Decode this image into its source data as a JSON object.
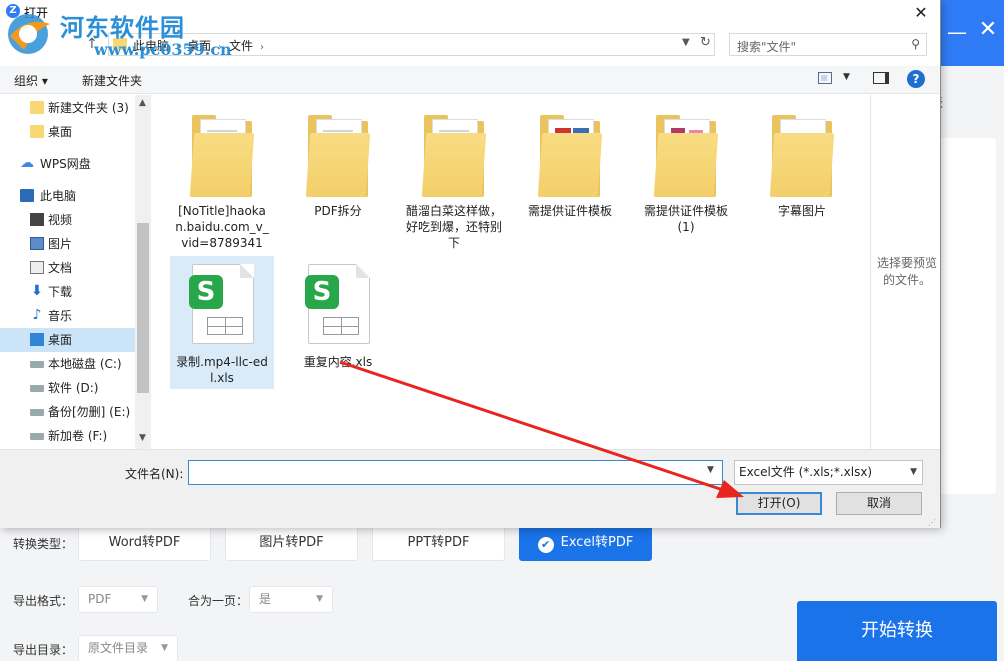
{
  "app": {
    "list_label": "表",
    "convert_type_label": "转换类型：",
    "type_buttons": [
      "Word转PDF",
      "图片转PDF",
      "PPT转PDF",
      "Excel转PDF"
    ],
    "export_format_label": "导出格式：",
    "export_format_value": "PDF",
    "merge_label": "合为一页：",
    "merge_value": "是",
    "export_dir_label": "导出目录：",
    "export_dir_value": "原文件目录",
    "start_button": "开始转换"
  },
  "watermark": {
    "name": "河东软件园",
    "url": "www.pc0359.cn"
  },
  "dialog": {
    "title": "打开",
    "breadcrumbs": [
      "此电脑",
      "桌面",
      "文件"
    ],
    "search_placeholder": "搜索\"文件\"",
    "toolbar": {
      "organize": "组织 ▾",
      "new_folder": "新建文件夹"
    },
    "nav_items": [
      {
        "label": "新建文件夹 (3)",
        "icon": "folder-icon"
      },
      {
        "label": "桌面",
        "icon": "folder-icon"
      },
      {
        "label": "WPS网盘",
        "icon": "cloud-icon"
      },
      {
        "label": "此电脑",
        "icon": "computer-icon"
      },
      {
        "label": "视频",
        "icon": "video-icon"
      },
      {
        "label": "图片",
        "icon": "picture-icon"
      },
      {
        "label": "文档",
        "icon": "document-icon"
      },
      {
        "label": "下载",
        "icon": "download-icon"
      },
      {
        "label": "音乐",
        "icon": "music-icon"
      },
      {
        "label": "桌面",
        "icon": "desktop-icon"
      },
      {
        "label": "本地磁盘 (C:)",
        "icon": "drive-icon"
      },
      {
        "label": "软件 (D:)",
        "icon": "drive-icon"
      },
      {
        "label": "备份[勿删] (E:)",
        "icon": "drive-icon"
      },
      {
        "label": "新加卷 (F:)",
        "icon": "drive-icon"
      }
    ],
    "files": [
      {
        "name": "[NoTitle]haokan.baidu.com_v_vid=8789341",
        "type": "folder"
      },
      {
        "name": "PDF拆分",
        "type": "folder"
      },
      {
        "name": "醋溜白菜这样做，好吃到爆，还特别下",
        "type": "folder"
      },
      {
        "name": "需提供证件模板",
        "type": "folder"
      },
      {
        "name": "需提供证件模板 (1)",
        "type": "folder"
      },
      {
        "name": "字幕图片",
        "type": "folder"
      },
      {
        "name": "录制.mp4-llc-edl.xls",
        "type": "xls"
      },
      {
        "name": "重复内容.xls",
        "type": "xls"
      }
    ],
    "preview_text": "选择要预览的文件。",
    "filename_label": "文件名(N):",
    "filename_value": "",
    "filter_value": "Excel文件 (*.xls;*.xlsx)",
    "open_button": "打开(O)",
    "cancel_button": "取消"
  },
  "colors": {
    "accent": "#1a73e8",
    "header": "#2f7bf5",
    "arrow": "#e8261d"
  }
}
